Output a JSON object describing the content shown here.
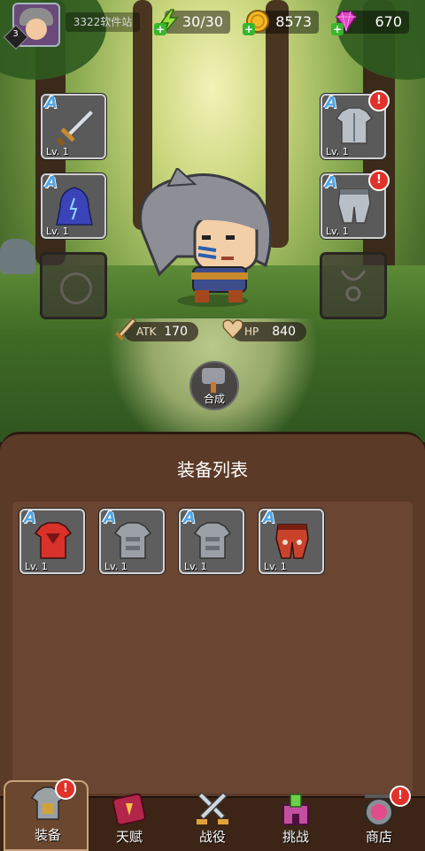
{
  "top_bar": {
    "player_level": "3",
    "site_label": "3322软件站",
    "energy": "30/30",
    "gold": "8573",
    "gems": "670"
  },
  "equipment_slots": {
    "weapon": {
      "grade": "A",
      "level": "Lv. 1"
    },
    "cloak": {
      "grade": "A",
      "level": "Lv. 1"
    },
    "armor": {
      "grade": "A",
      "level": "Lv. 1",
      "alert": "!"
    },
    "pants": {
      "grade": "A",
      "level": "Lv. 1",
      "alert": "!"
    }
  },
  "stats": {
    "atk_label": "ATK",
    "atk_value": "170",
    "hp_label": "HP",
    "hp_value": "840"
  },
  "merge_button": {
    "label": "合成"
  },
  "panel": {
    "title": "装备列表",
    "items": [
      {
        "grade": "A",
        "level": "Lv. 1",
        "color": "#d8322a"
      },
      {
        "grade": "A",
        "level": "Lv. 1",
        "color": "#9aa0a6"
      },
      {
        "grade": "A",
        "level": "Lv. 1",
        "color": "#9aa0a6"
      },
      {
        "grade": "A",
        "level": "Lv. 1",
        "color": "#c9432c"
      }
    ]
  },
  "nav": {
    "tabs": [
      {
        "label": "装备",
        "alert": "!"
      },
      {
        "label": "天赋"
      },
      {
        "label": "战役"
      },
      {
        "label": "挑战"
      },
      {
        "label": "商店",
        "alert": "!"
      }
    ]
  },
  "colors": {
    "grade_blue": "#4fa6e6",
    "alert_red": "#e0312a",
    "panel_brown": "#5b3b28"
  }
}
